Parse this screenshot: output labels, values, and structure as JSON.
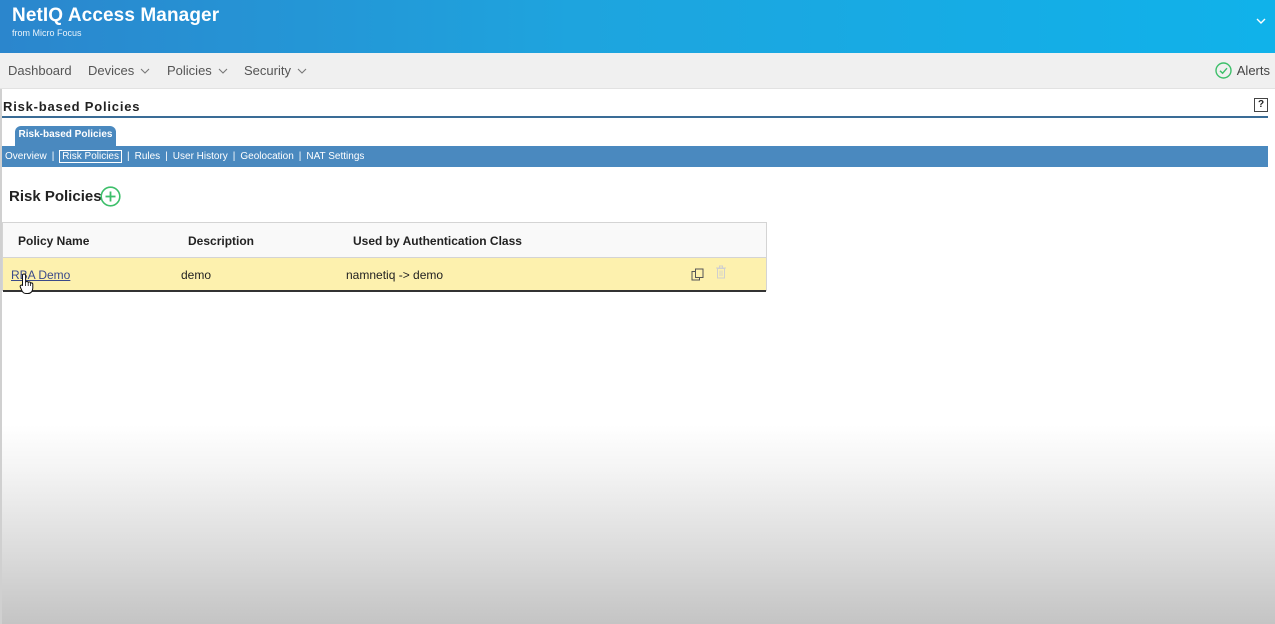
{
  "header": {
    "title": "NetIQ Access Manager",
    "subtitle": "from Micro Focus",
    "menu_icon": "chevron-down-icon"
  },
  "nav": {
    "items": [
      {
        "label": "Dashboard",
        "has_dropdown": false
      },
      {
        "label": "Devices",
        "has_dropdown": true
      },
      {
        "label": "Policies",
        "has_dropdown": true
      },
      {
        "label": "Security",
        "has_dropdown": true
      }
    ],
    "alerts": {
      "label": "Alerts",
      "icon": "check-circle-icon"
    }
  },
  "page": {
    "title": "Risk-based Policies",
    "help_label": "?"
  },
  "tabs": {
    "main": "Risk-based Policies",
    "subnav": [
      "Overview",
      "Risk Policies",
      "Rules",
      "User History",
      "Geolocation",
      "NAT Settings"
    ],
    "active": "Risk Policies",
    "separator": "|"
  },
  "section": {
    "title": "Risk Policies",
    "add_icon": "plus-circle-icon"
  },
  "table": {
    "headers": [
      "Policy Name",
      "Description",
      "Used by Authentication Class"
    ],
    "rows": [
      {
        "name": "RBA Demo",
        "description": "demo",
        "auth_class": "namnetiq -> demo"
      }
    ]
  },
  "colors": {
    "header_gradient_start": "#2b86cd",
    "header_gradient_end": "#10b2ea",
    "tab_blue": "#4a89bf",
    "selected_row": "#fdf1ae",
    "add_green": "#3dbf6a"
  }
}
